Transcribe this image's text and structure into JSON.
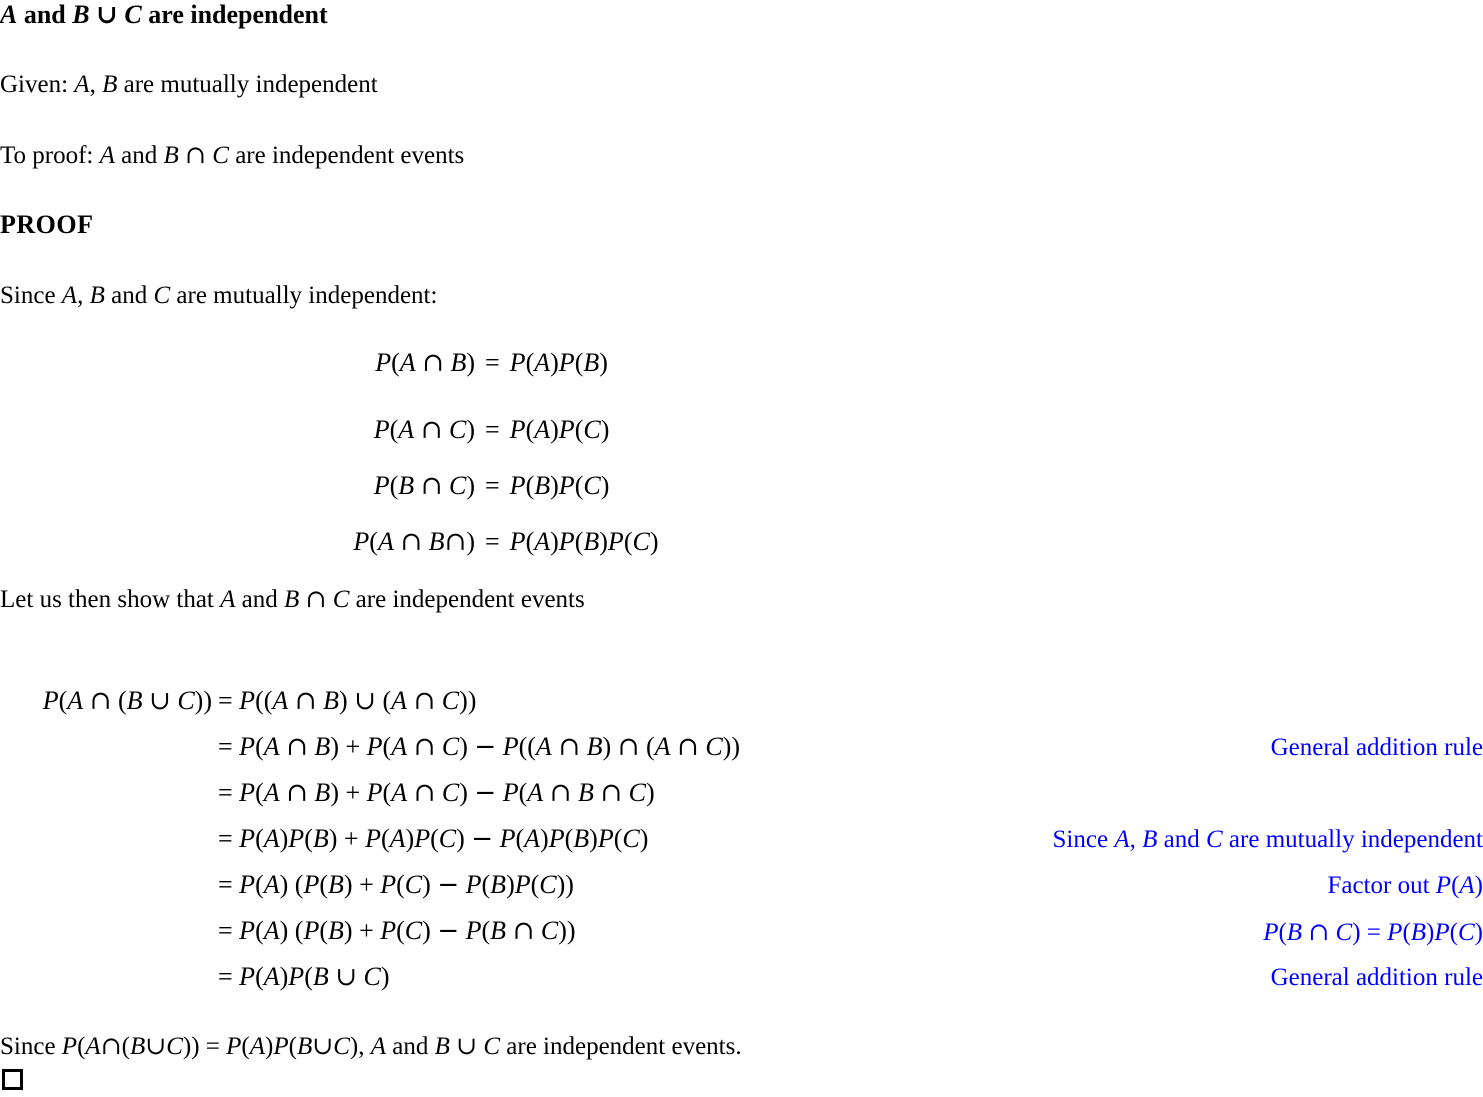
{
  "document": {
    "title_parts": {
      "a": "A",
      "and": " and ",
      "bc": "B ∪ C",
      "tail": " are independent"
    },
    "title_text": "A and B ∪ C are independent",
    "given": "Given:  A, B are mutually independent",
    "to_proof": "To proof:  A and B ∩ C are independent events",
    "proof_heading": "PROOF",
    "since_mutual": "Since  A, B and C are mutually independent:",
    "let_us": "Let us then show that A and B ∩ C are independent events",
    "conclusion": "Since P(A∩(B∪C)) = P(A)P(B∪C), A and B ∪ C are independent events.",
    "qed_symbol": "□"
  },
  "display_equations": [
    {
      "lhs": "P(A ∩ B)",
      "rel": "=",
      "rhs": "P(A)P(B)"
    },
    {
      "lhs": "P(A ∩ C)",
      "rel": "=",
      "rhs": "P(A)P(C)"
    },
    {
      "lhs": "P(B ∩ C)",
      "rel": "=",
      "rhs": "P(B)P(C)"
    },
    {
      "lhs": "P(A ∩ B∩)",
      "rel": "=",
      "rhs": "P(A)P(B)P(C)"
    }
  ],
  "derivation": {
    "lhs": "P(A ∩ (B ∪ C))",
    "rows": [
      {
        "rel": "= P((A ∩ B) ∪ (A ∩ C))",
        "note": ""
      },
      {
        "rel": "= P(A ∩ B) + P(A ∩ C) − P((A ∩ B) ∩ (A ∩ C))",
        "note": "General addition rule"
      },
      {
        "rel": "= P(A ∩ B) + P(A ∩ C) − P(A ∩ B ∩ C)",
        "note": ""
      },
      {
        "rel": "= P(A)P(B) + P(A)P(C) − P(A)P(B)P(C)",
        "note": "Since A, B and C are mutually independent"
      },
      {
        "rel": "= P(A) (P(B) + P(C) − P(B)P(C))",
        "note": "Factor out P(A)"
      },
      {
        "rel": "= P(A) (P(B) + P(C) − P(B ∩ C))",
        "note": "P(B ∩ C) = P(B)P(C)"
      },
      {
        "rel": "= P(A)P(B ∪ C)",
        "note": "General addition rule"
      }
    ]
  },
  "colors": {
    "text": "#000000",
    "annotation": "#0000ff",
    "background": "#ffffff"
  }
}
